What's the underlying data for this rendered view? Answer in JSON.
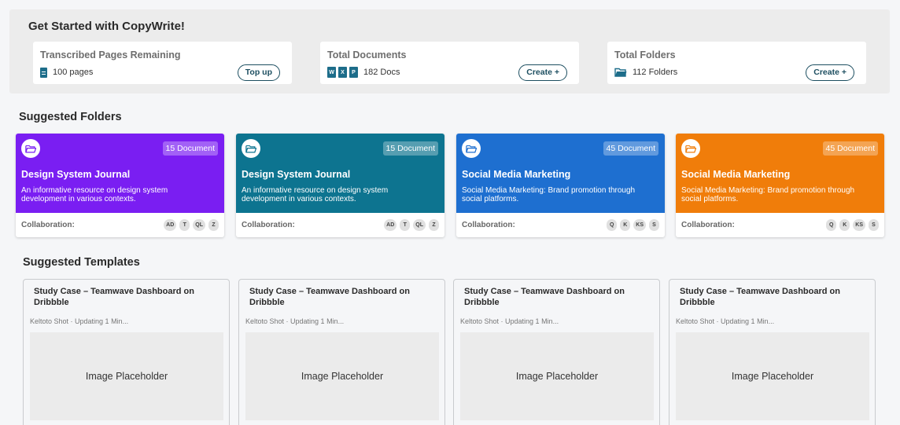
{
  "header": {
    "title": "Get Started with CopyWrite!"
  },
  "stats": [
    {
      "label": "Transcribed Pages Remaining",
      "value": "100 pages",
      "button": "Top up",
      "icon": "file-icon"
    },
    {
      "label": "Total Documents",
      "value": "182 Docs",
      "button": "Create +",
      "icons": [
        "W",
        "X",
        "PDF"
      ]
    },
    {
      "label": "Total Folders",
      "value": "112 Folders",
      "button": "Create +",
      "icon": "folder-icon"
    }
  ],
  "suggested_folders": {
    "title": "Suggested Folders",
    "items": [
      {
        "color": "#7a1ef2",
        "badge": "15 Document",
        "title": "Design System Journal",
        "description": "An informative resource on design system development in various contexts.",
        "collab_label": "Collaboration:",
        "avatars": [
          "AD",
          "T",
          "QL",
          "Z"
        ]
      },
      {
        "color": "#0d7490",
        "badge": "15 Document",
        "title": "Design System Journal",
        "description": "An informative resource on design system development in various contexts.",
        "collab_label": "Collaboration:",
        "avatars": [
          "AD",
          "T",
          "QL",
          "Z"
        ]
      },
      {
        "color": "#1e6fd0",
        "badge": "45 Document",
        "title": "Social Media Marketing",
        "description": "Social Media Marketing: Brand promotion through social platforms.",
        "collab_label": "Collaboration:",
        "avatars": [
          "Q",
          "K",
          "KS",
          "S"
        ]
      },
      {
        "color": "#f07d0a",
        "badge": "45 Document",
        "title": "Social Media Marketing",
        "description": "Social Media Marketing: Brand promotion through social platforms.",
        "collab_label": "Collaboration:",
        "avatars": [
          "Q",
          "K",
          "KS",
          "S"
        ]
      }
    ]
  },
  "suggested_templates": {
    "title": "Suggested Templates",
    "items": [
      {
        "title": "Study Case – Teamwave Dashboard on Dribbble",
        "meta": "Keltoto Shot · Updating 1 Min...",
        "image": "Image Placeholder"
      },
      {
        "title": "Study Case – Teamwave Dashboard on Dribbble",
        "meta": "Keltoto Shot · Updating 1 Min...",
        "image": "Image Placeholder"
      },
      {
        "title": "Study Case – Teamwave Dashboard on Dribbble",
        "meta": "Keltoto Shot · Updating 1 Min...",
        "image": "Image Placeholder"
      },
      {
        "title": "Study Case – Teamwave Dashboard on Dribbble",
        "meta": "Keltoto Shot · Updating 1 Min...",
        "image": "Image Placeholder"
      }
    ]
  }
}
